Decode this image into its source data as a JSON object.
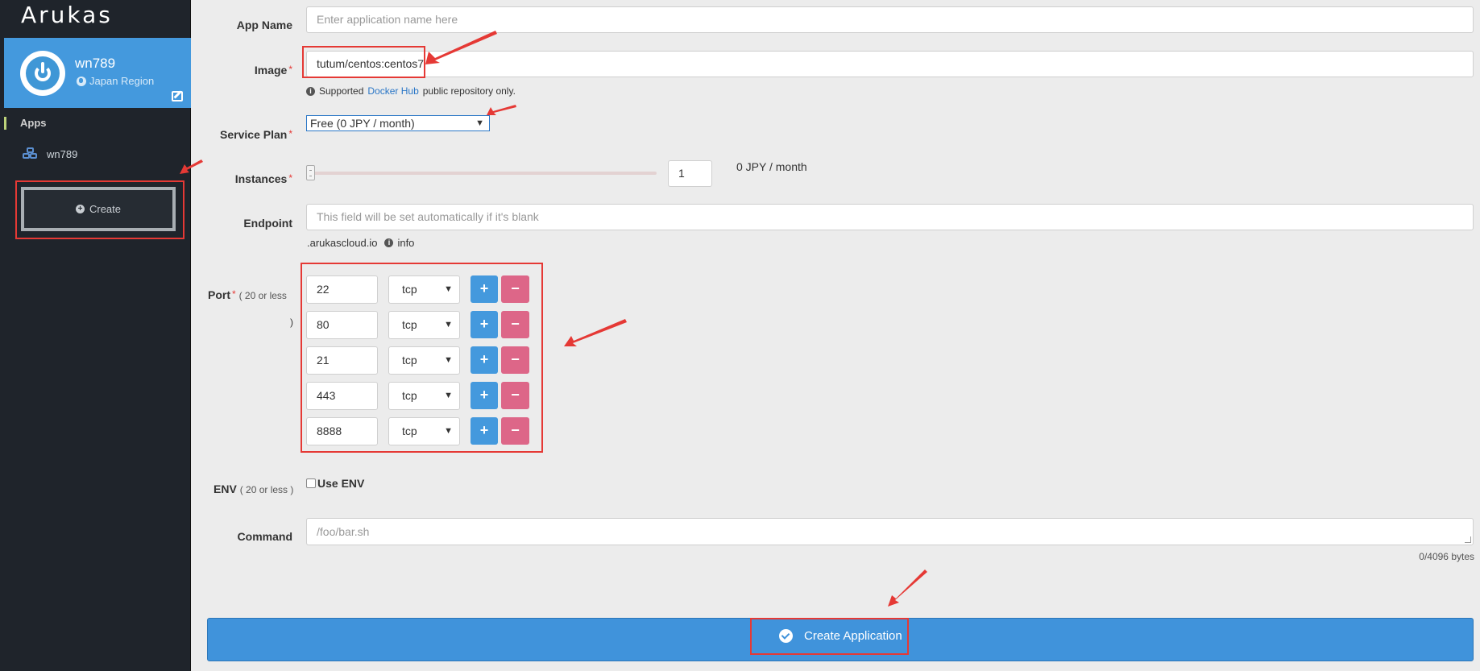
{
  "sidebar": {
    "logo": "Arukas",
    "profile_name": "wn789",
    "region": "Japan Region",
    "apps_header": "Apps",
    "app_item": "wn789",
    "create_label": "Create"
  },
  "form": {
    "app_name_label": "App Name",
    "app_name_placeholder": "Enter application name here",
    "image_label": "Image",
    "image_value": "tutum/centos:centos7",
    "image_hint_pre": "Supported",
    "image_hint_link": "Docker Hub",
    "image_hint_post": "public repository only.",
    "plan_label": "Service Plan",
    "plan_value": "Free (0 JPY / month)",
    "instances_label": "Instances",
    "instances_value": "1",
    "instances_slider_value": 1,
    "instances_price": "0 JPY / month",
    "endpoint_label": "Endpoint",
    "endpoint_placeholder": "This field will be set automatically if it's blank",
    "endpoint_domain": ".arukascloud.io",
    "endpoint_info": "info",
    "port_label": "Port",
    "port_limit_a": "( 20 or less",
    "port_limit_b": ")",
    "ports": [
      {
        "number": "22",
        "protocol": "tcp"
      },
      {
        "number": "80",
        "protocol": "tcp"
      },
      {
        "number": "21",
        "protocol": "tcp"
      },
      {
        "number": "443",
        "protocol": "tcp"
      },
      {
        "number": "8888",
        "protocol": "tcp"
      }
    ],
    "plus_label": "+",
    "minus_label": "−",
    "env_label": "ENV",
    "env_limit": "( 20 or less )",
    "use_env_label": "Use ENV",
    "command_label": "Command",
    "command_placeholder": "/foo/bar.sh",
    "command_bytes": "0/4096 bytes",
    "submit_label": "Create Application",
    "required_mark": "*"
  },
  "colors": {
    "accent": "#4499dd",
    "danger": "#dd6688",
    "annotation": "#e53935",
    "sidebar_bg": "#1f242b"
  }
}
